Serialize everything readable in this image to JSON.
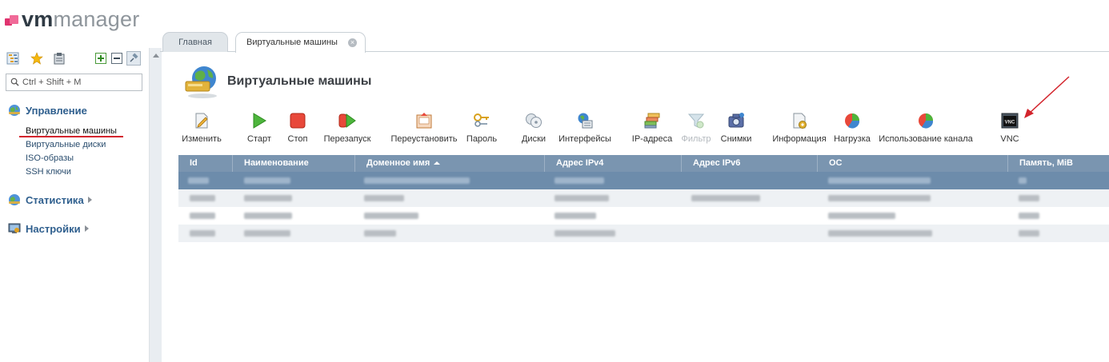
{
  "app": {
    "logo_vm": "vm",
    "logo_manager": "manager",
    "brand_color": "#e0336f"
  },
  "sidebar": {
    "toolbar_icons": [
      "tree-view-icon",
      "favorites-star-icon",
      "clipboard-icon",
      "expand-all-icon",
      "collapse-all-icon",
      "pin-icon"
    ],
    "search": {
      "placeholder": "Ctrl + Shift + M",
      "value": ""
    },
    "sections": [
      {
        "label": "Управление",
        "icon": "globe-icon",
        "expanded": true,
        "items": [
          {
            "label": "Виртуальные машины",
            "active": true
          },
          {
            "label": "Виртуальные диски"
          },
          {
            "label": "ISO-образы"
          },
          {
            "label": "SSH ключи"
          }
        ]
      },
      {
        "label": "Статистика",
        "icon": "chart-icon",
        "expanded": false
      },
      {
        "label": "Настройки",
        "icon": "settings-monitor-icon",
        "expanded": false
      }
    ]
  },
  "tabs": [
    {
      "label": "Главная",
      "active": false
    },
    {
      "label": "Виртуальные машины",
      "active": true,
      "closable": true
    }
  ],
  "page": {
    "title": "Виртуальные машины",
    "icon": "vm-globe-icon"
  },
  "toolbar": [
    {
      "label": "Изменить",
      "icon": "edit-icon",
      "enabled": true
    },
    {
      "label": "Старт",
      "icon": "play-icon",
      "enabled": true
    },
    {
      "label": "Стоп",
      "icon": "stop-icon",
      "enabled": true
    },
    {
      "label": "Перезапуск",
      "icon": "restart-icon",
      "enabled": true
    },
    {
      "label": "Переустановить",
      "icon": "reinstall-icon",
      "enabled": true
    },
    {
      "label": "Пароль",
      "icon": "key-icon",
      "enabled": true
    },
    {
      "label": "Диски",
      "icon": "disks-icon",
      "enabled": true
    },
    {
      "label": "Интерфейсы",
      "icon": "interfaces-icon",
      "enabled": true
    },
    {
      "label": "IP-адреса",
      "icon": "ip-addresses-icon",
      "enabled": true
    },
    {
      "label": "Фильтр",
      "icon": "filter-icon",
      "enabled": false
    },
    {
      "label": "Снимки",
      "icon": "camera-icon",
      "enabled": true
    },
    {
      "label": "Информация",
      "icon": "info-icon",
      "enabled": true
    },
    {
      "label": "Нагрузка",
      "icon": "load-pie-icon",
      "enabled": true
    },
    {
      "label": "Использование канала",
      "icon": "bandwidth-pie-icon",
      "enabled": true
    },
    {
      "label": "VNC",
      "icon": "vnc-icon",
      "enabled": true
    }
  ],
  "table": {
    "columns": [
      "Id",
      "Наименование",
      "Доменное имя",
      "Адрес IPv4",
      "Адрес IPv6",
      "ОС",
      "Память, MiB"
    ],
    "sort_column": "Доменное имя",
    "sort_direction": "asc",
    "row_count": 4,
    "note_values_blurred": true
  },
  "colors": {
    "header_bg": "#7a95b0",
    "selected_row": "#6d8cab",
    "annotation_arrow": "#d3242c"
  }
}
